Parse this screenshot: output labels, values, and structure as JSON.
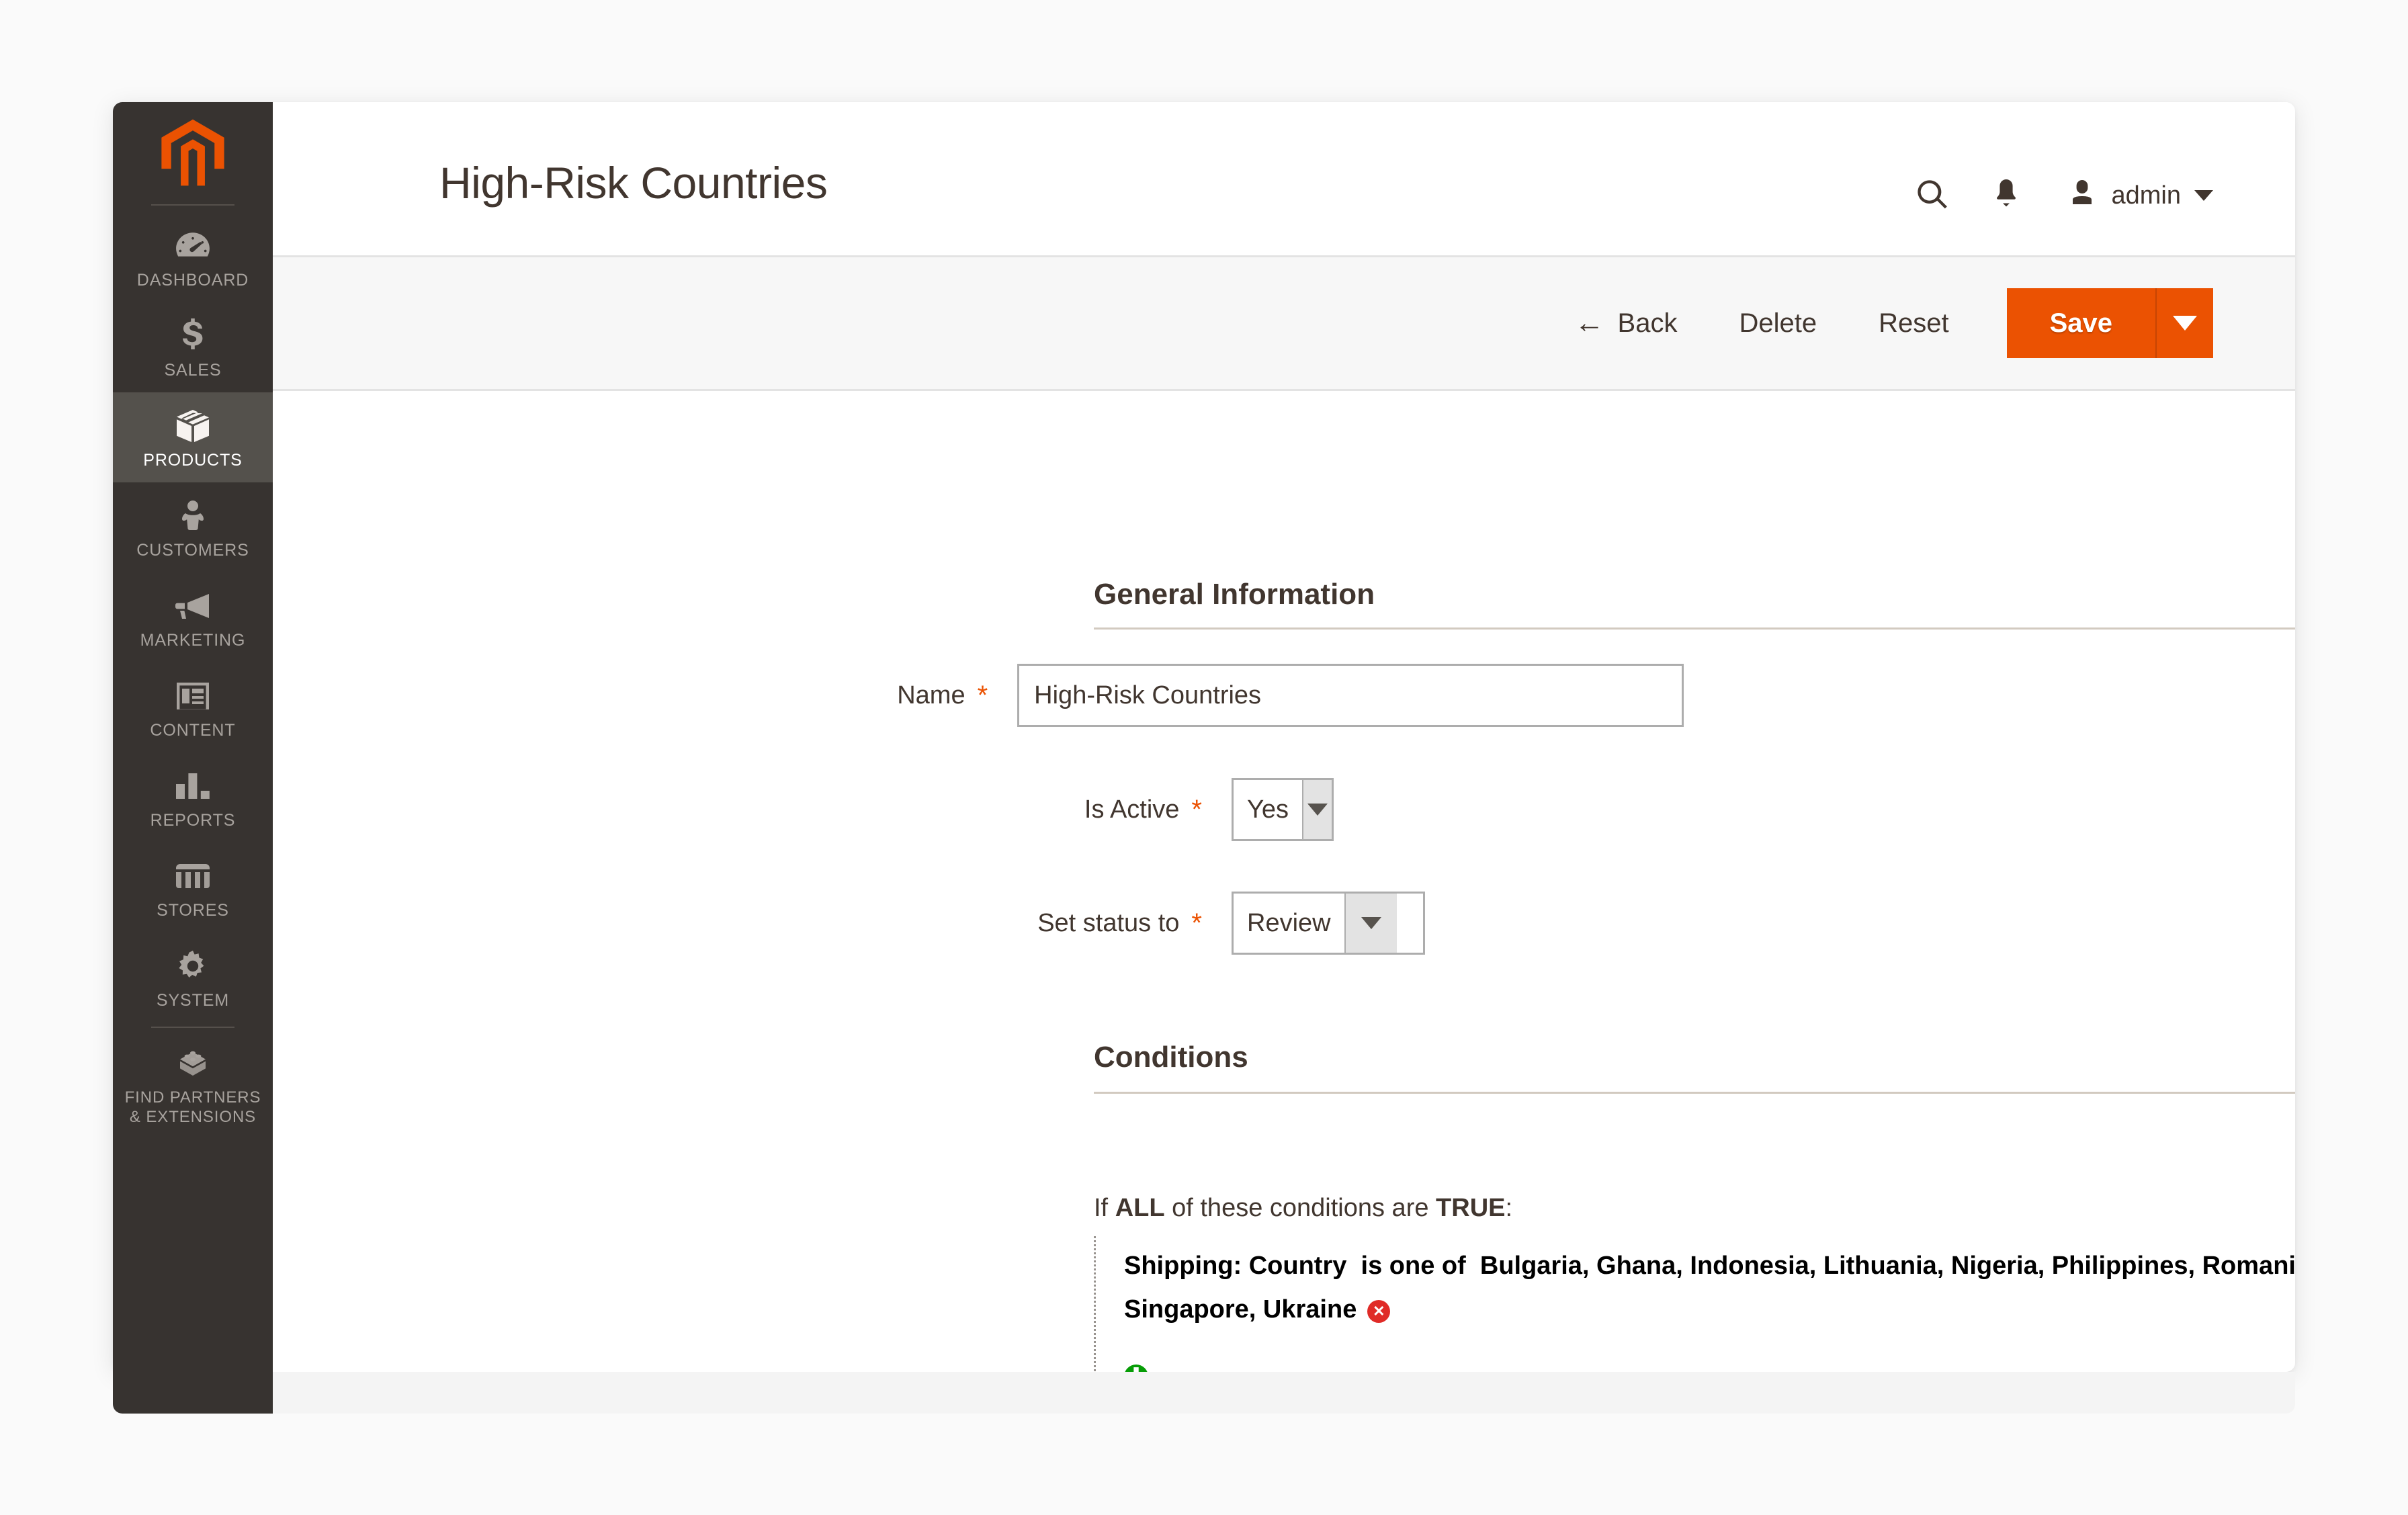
{
  "brand": {
    "logo_icon": "magento-logo-icon",
    "accent_color": "#eb5202",
    "sidebar_color": "#373330"
  },
  "sidebar": {
    "items": [
      {
        "label": "DASHBOARD",
        "icon": "dashboard-gauge-icon",
        "active": false
      },
      {
        "label": "SALES",
        "icon": "dollar-sign-icon",
        "active": false
      },
      {
        "label": "PRODUCTS",
        "icon": "box-icon",
        "active": true
      },
      {
        "label": "CUSTOMERS",
        "icon": "person-icon",
        "active": false
      },
      {
        "label": "MARKETING",
        "icon": "megaphone-icon",
        "active": false
      },
      {
        "label": "CONTENT",
        "icon": "layout-icon",
        "active": false
      },
      {
        "label": "REPORTS",
        "icon": "bar-chart-icon",
        "active": false
      },
      {
        "label": "STORES",
        "icon": "storefront-icon",
        "active": false
      },
      {
        "label": "SYSTEM",
        "icon": "gear-icon",
        "active": false
      }
    ],
    "partners": {
      "label": "FIND PARTNERS\n& EXTENSIONS",
      "line1": "FIND PARTNERS",
      "line2": "& EXTENSIONS",
      "icon": "extension-block-icon"
    }
  },
  "header": {
    "title": "High-Risk Countries",
    "search_icon": "search-icon",
    "notifications_icon": "bell-icon",
    "user_icon": "user-avatar-icon",
    "admin_label": "admin",
    "caret_icon": "chevron-down-icon"
  },
  "toolbar": {
    "back_label": "Back",
    "back_icon": "arrow-left-icon",
    "delete_label": "Delete",
    "reset_label": "Reset",
    "save_label": "Save",
    "save_split_icon": "chevron-down-icon"
  },
  "general": {
    "section_title": "General Information",
    "name": {
      "label": "Name",
      "required": "*",
      "value": "High-Risk Countries",
      "placeholder": ""
    },
    "is_active": {
      "label": "Is Active",
      "required": "*",
      "value": "Yes"
    },
    "set_status": {
      "label": "Set status to",
      "required": "*",
      "value": "Review"
    }
  },
  "conditions": {
    "section_title": "Conditions",
    "intro_prefix": "If",
    "intro_aggregator": "ALL",
    "intro_middle": "of these conditions are",
    "intro_value": "TRUE",
    "intro_suffix": ":",
    "rule": {
      "attribute": "Shipping: Country",
      "operator": "is one of",
      "value": "Bulgaria, Ghana, Indonesia, Lithuania, Nigeria, Philippines, Romania, Russia, Singapore, Ukraine",
      "remove_icon": "remove-circle-icon",
      "remove_glyph": "✕"
    },
    "add_icon": "add-circle-icon",
    "add_glyph": "✚"
  }
}
